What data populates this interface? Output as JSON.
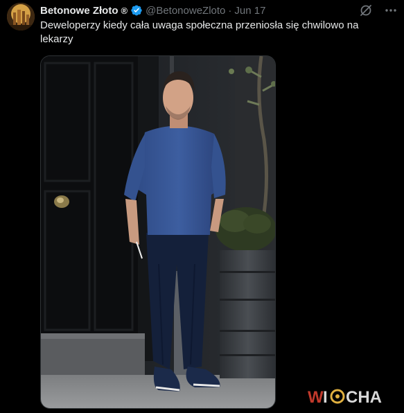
{
  "tweet": {
    "author_name": "Betonowe Złoto",
    "author_badge": "®",
    "handle": "@BetonoweZloto",
    "separator": "·",
    "date": "Jun 17",
    "text": "Deweloperzy kiedy cała uwaga społeczna przeniosła się chwilowo na lekarzy",
    "verified_icon": "verified-badge-icon",
    "accent_color": "#1d9bf0"
  },
  "actions": {
    "grok_icon": "grok-icon",
    "more_icon": "more-options-icon"
  },
  "watermark": {
    "text": "WIOCHA",
    "color": "#c0392b"
  }
}
